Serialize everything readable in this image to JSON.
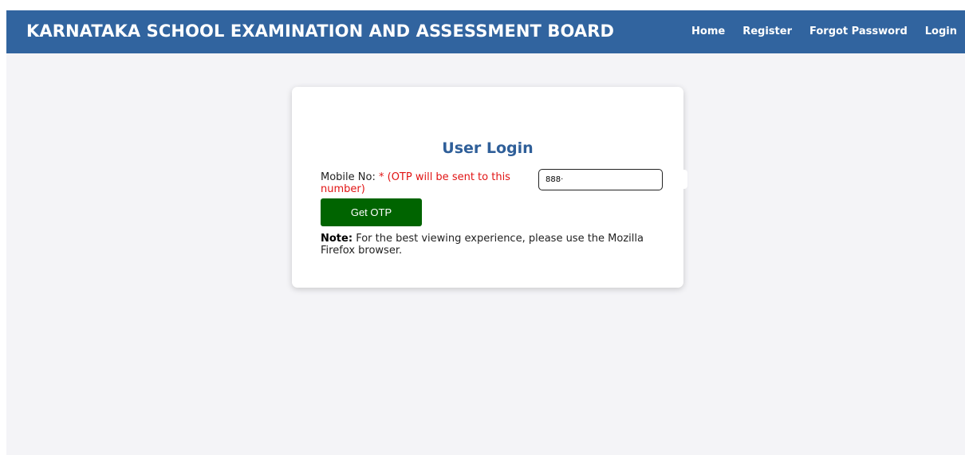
{
  "header": {
    "title": "KARNATAKA SCHOOL EXAMINATION AND ASSESSMENT BOARD",
    "nav": [
      "Home",
      "Register",
      "Forgot Password",
      "Login"
    ]
  },
  "login": {
    "title": "User Login",
    "mobile_label": "Mobile No:",
    "mobile_hint": "* (OTP will be sent to this number)",
    "mobile_value": "888·",
    "get_otp": "Get OTP",
    "note_label": "Note:",
    "note_text": "For the best viewing experience, please use the Mozilla Firefox browser."
  },
  "colors": {
    "header": "#31649f",
    "title": "#2f5f99",
    "button": "#006400",
    "required": "#e11414"
  }
}
